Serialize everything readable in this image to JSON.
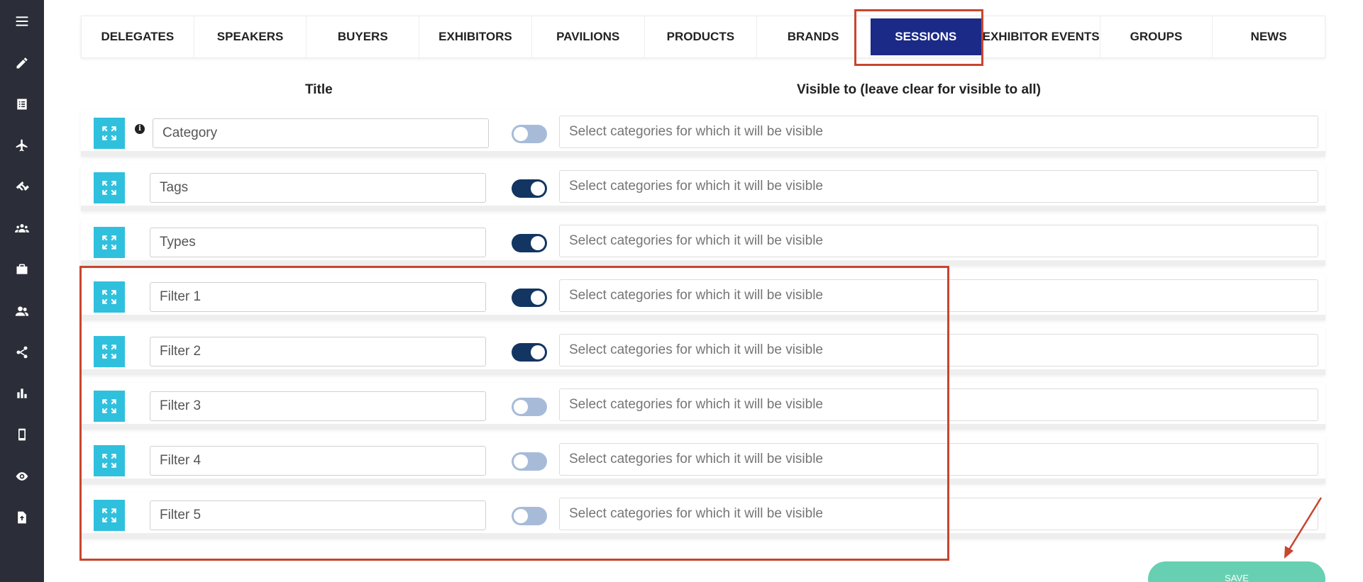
{
  "sidebar": {
    "icons": [
      "menu-icon",
      "pencil-icon",
      "list-icon",
      "plane-icon",
      "tag-icon",
      "group-icon",
      "briefcase-icon",
      "users-icon",
      "share-icon",
      "bar-chart-icon",
      "mobile-icon",
      "eye-icon",
      "file-upload-icon"
    ]
  },
  "tabs": [
    {
      "label": "DELEGATES"
    },
    {
      "label": "SPEAKERS"
    },
    {
      "label": "BUYERS"
    },
    {
      "label": "EXHIBITORS"
    },
    {
      "label": "PAVILIONS"
    },
    {
      "label": "PRODUCTS"
    },
    {
      "label": "BRANDS"
    },
    {
      "label": "SESSIONS",
      "active": true
    },
    {
      "label": "EXHIBITOR EVENTS"
    },
    {
      "label": "GROUPS"
    },
    {
      "label": "NEWS"
    }
  ],
  "columns": {
    "title": "Title",
    "visible_to": "Visible to (leave clear for visible to all)"
  },
  "rows": [
    {
      "title": "Category",
      "toggle_on": false,
      "placeholder": "Select categories for which it will be visible",
      "has_info": true
    },
    {
      "title": "Tags",
      "toggle_on": true,
      "placeholder": "Select categories for which it will be visible"
    },
    {
      "title": "Types",
      "toggle_on": true,
      "placeholder": "Select categories for which it will be visible"
    },
    {
      "title": "Filter 1",
      "toggle_on": true,
      "placeholder": "Select categories for which it will be visible"
    },
    {
      "title": "Filter 2",
      "toggle_on": true,
      "placeholder": "Select categories for which it will be visible"
    },
    {
      "title": "Filter 3",
      "toggle_on": false,
      "placeholder": "Select categories for which it will be visible"
    },
    {
      "title": "Filter 4",
      "toggle_on": false,
      "placeholder": "Select categories for which it will be visible"
    },
    {
      "title": "Filter 5",
      "toggle_on": false,
      "placeholder": "Select categories for which it will be visible"
    }
  ],
  "save_label": "SAVE",
  "colors": {
    "sidebar": "#2b2d38",
    "active_tab": "#1b2a86",
    "drag_button": "#2fc0dd",
    "toggle_on": "#123562",
    "toggle_off": "#a7bbd9",
    "save_button": "#67d0b2",
    "annotation": "#c8452e"
  }
}
